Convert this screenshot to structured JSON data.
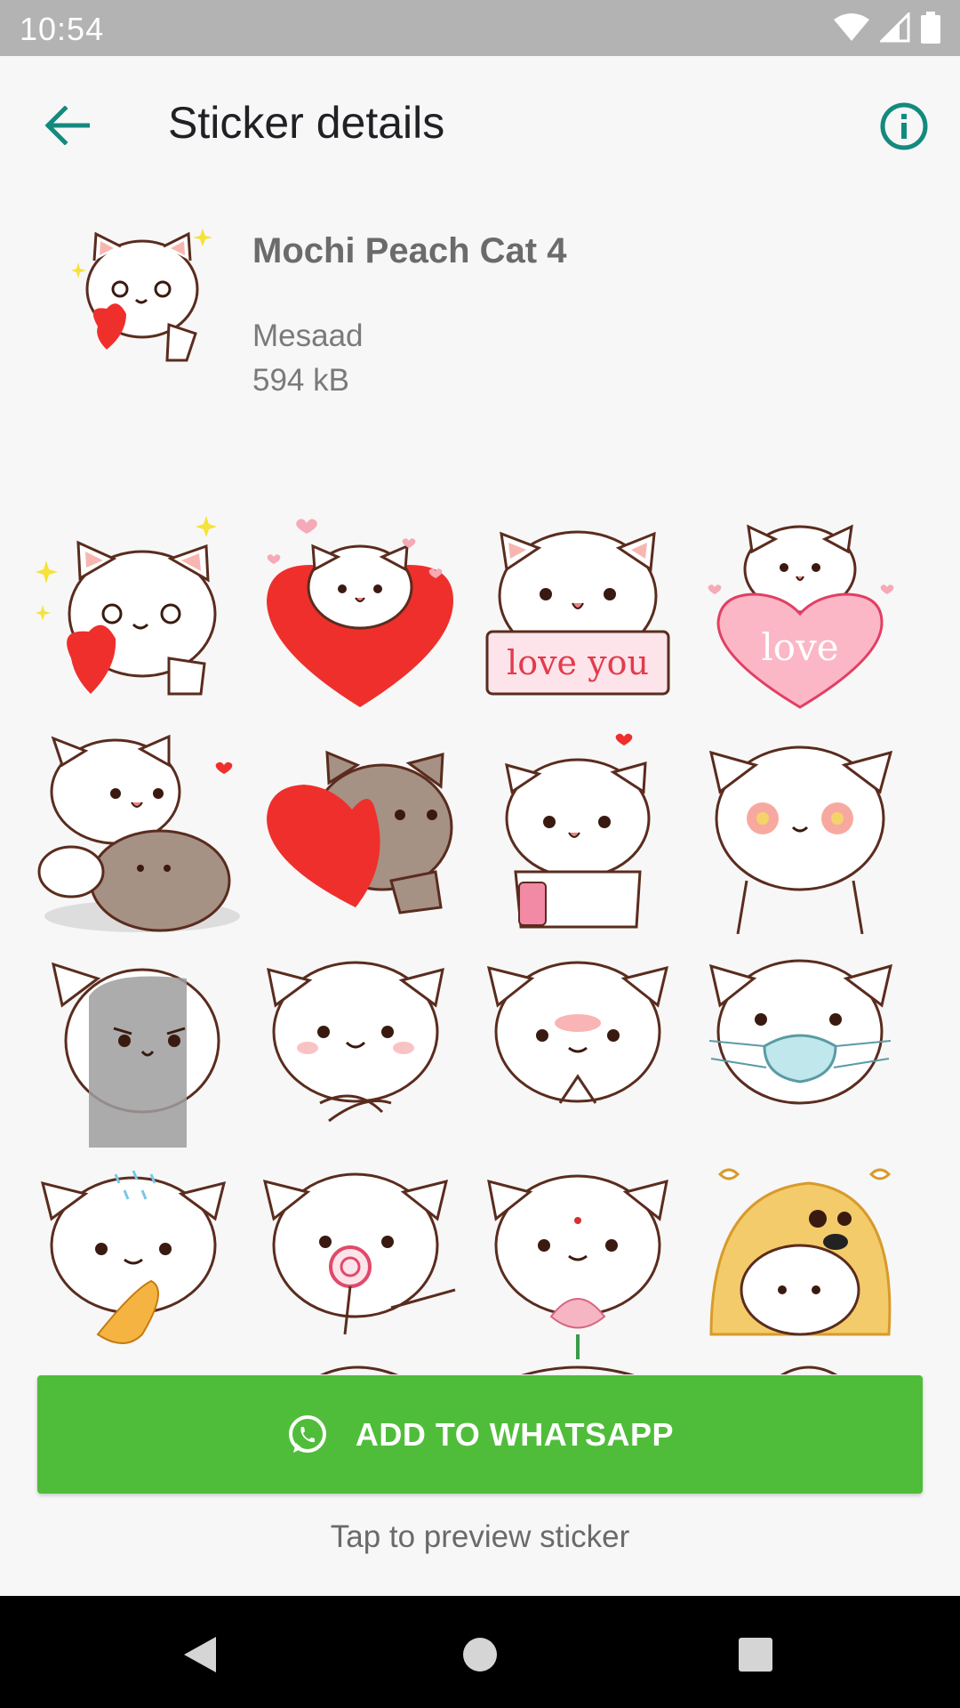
{
  "status_bar": {
    "time": "10:54"
  },
  "app_bar": {
    "title": "Sticker details",
    "back_icon": "arrow-back-icon",
    "info_icon": "info-icon"
  },
  "pack": {
    "name": "Mochi Peach Cat 4",
    "publisher": "Mesaad",
    "size": "594 kB"
  },
  "stickers": [
    {
      "id": "cat-heart-sparkles"
    },
    {
      "id": "cat-big-red-heart",
      "text": ""
    },
    {
      "id": "cat-love-you-sign",
      "text": "love you"
    },
    {
      "id": "cat-pink-love-heart",
      "text": "love"
    },
    {
      "id": "cat-hug-brown-cat"
    },
    {
      "id": "brown-cat-red-heart"
    },
    {
      "id": "cat-phone"
    },
    {
      "id": "cat-flower-eyes"
    },
    {
      "id": "cat-gray-shadow"
    },
    {
      "id": "cat-crossed-arms"
    },
    {
      "id": "cat-blushing-hands"
    },
    {
      "id": "cat-face-mask"
    },
    {
      "id": "cat-sweat-fish"
    },
    {
      "id": "cat-lollipop-point"
    },
    {
      "id": "cat-lotus"
    },
    {
      "id": "doge-hood-cat"
    }
  ],
  "actions": {
    "add_label": "ADD TO WHATSAPP",
    "hint": "Tap to preview sticker"
  },
  "colors": {
    "accent": "#138a7e",
    "button": "#4fbd3a",
    "heart": "#f0392c"
  }
}
